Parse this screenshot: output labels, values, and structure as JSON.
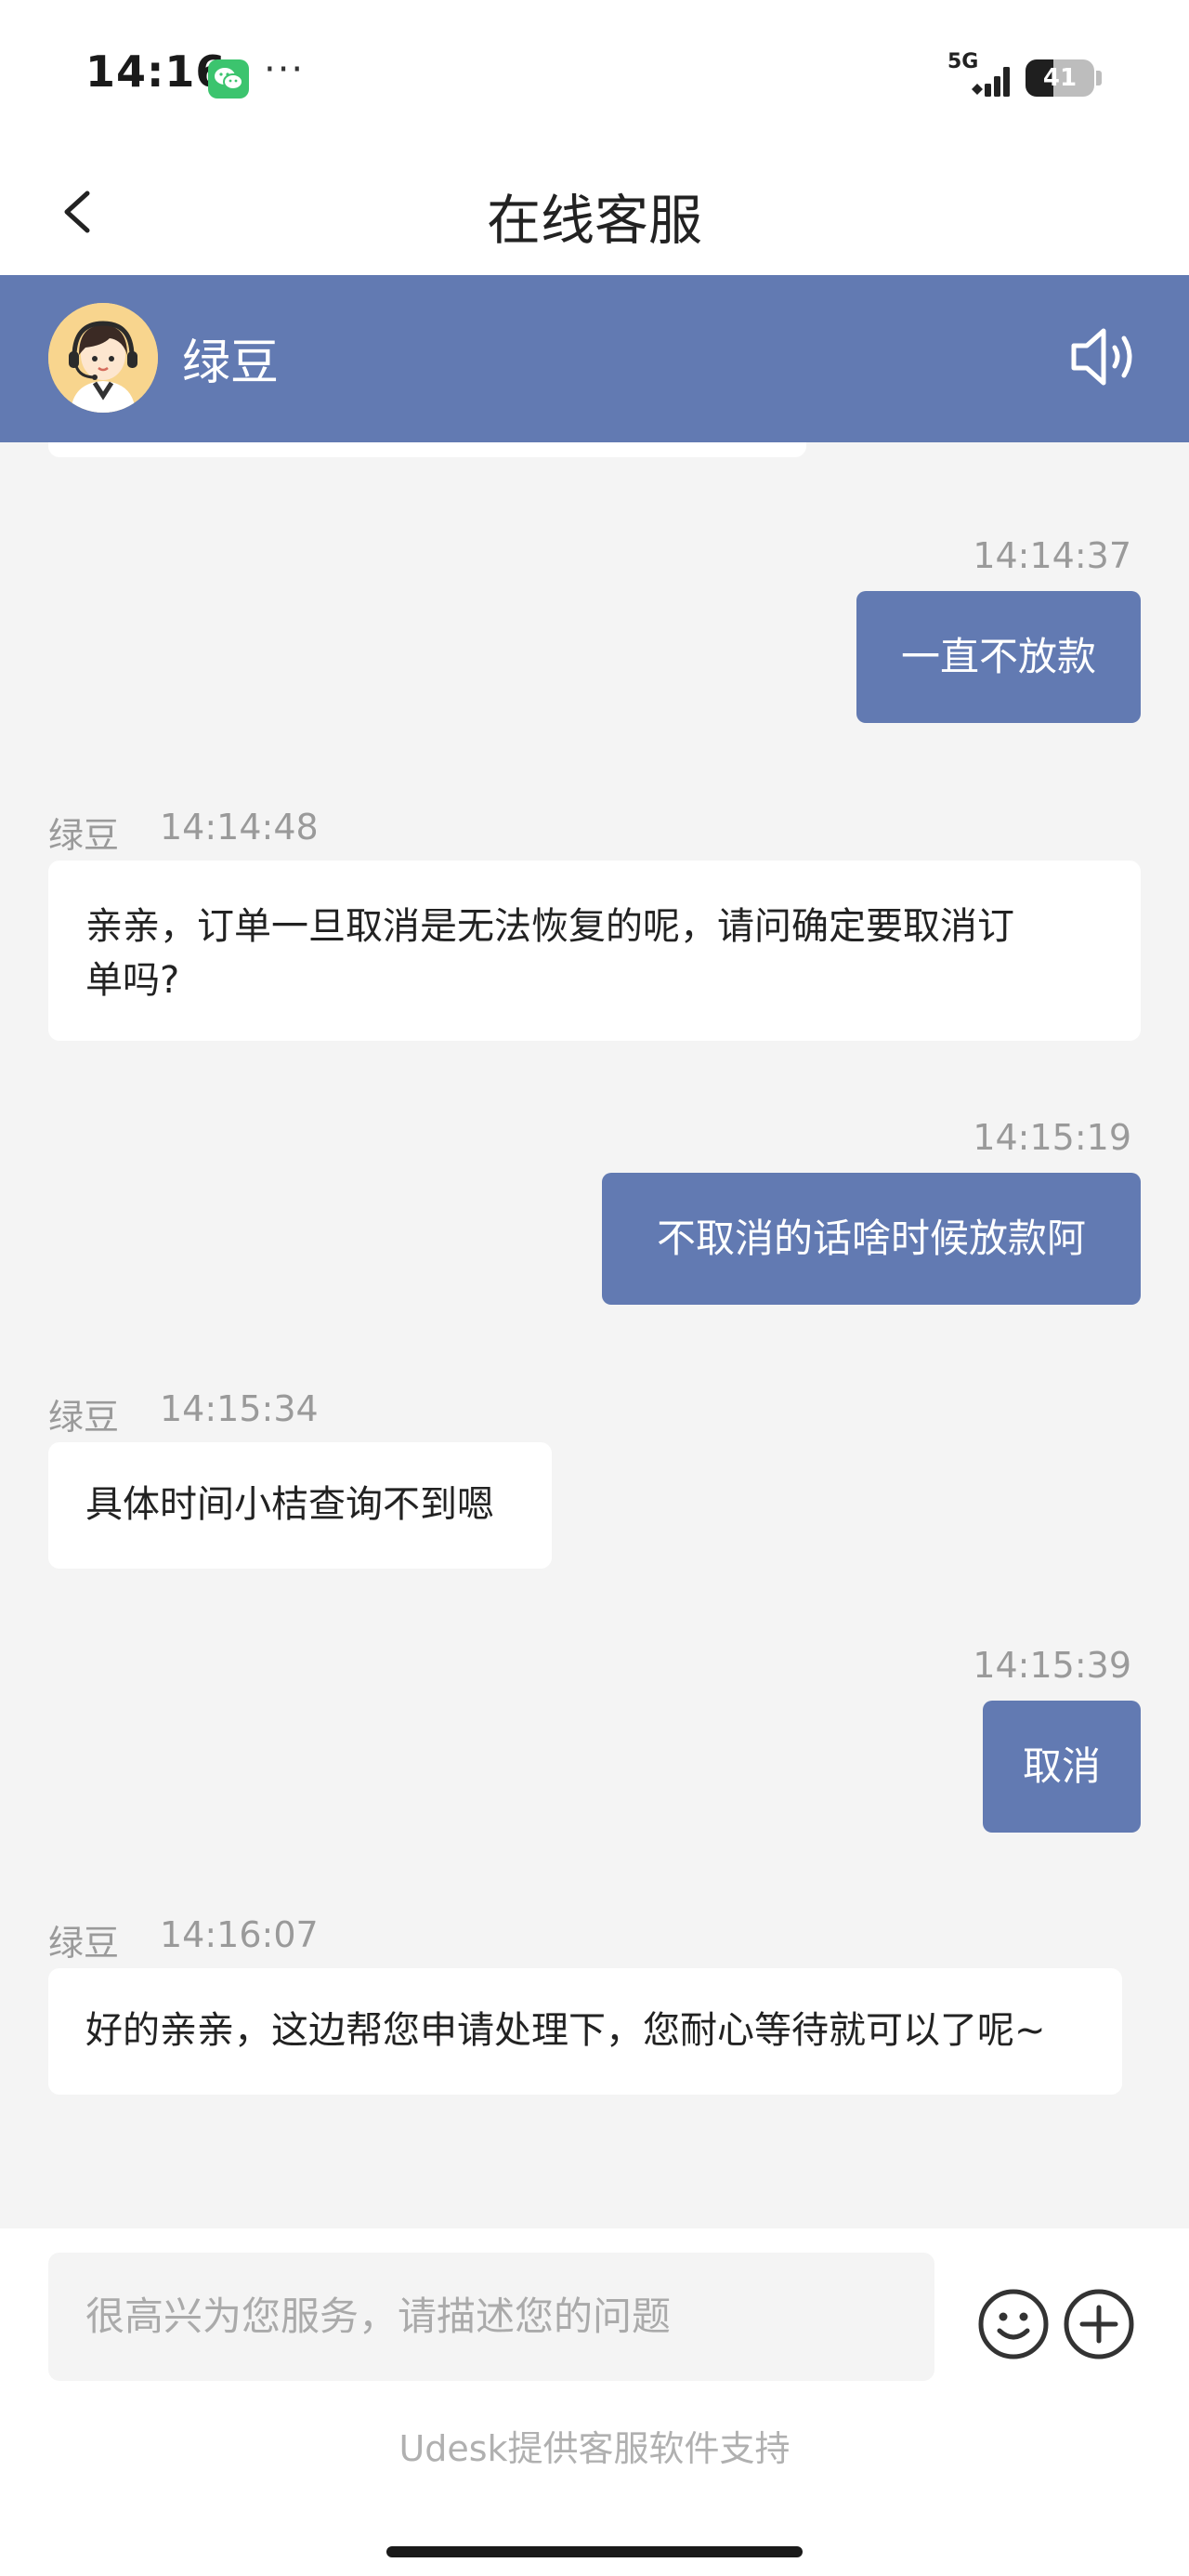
{
  "status_bar": {
    "time": "14:16",
    "dots": "···",
    "network": "5G",
    "battery": "41",
    "battery_level": 0.41
  },
  "nav": {
    "title": "在线客服"
  },
  "agent": {
    "name": "绿豆"
  },
  "messages": [
    {
      "side": "me",
      "time": "14:14:37",
      "text": "一直不放款"
    },
    {
      "side": "them",
      "sender": "绿豆",
      "time": "14:14:48",
      "lines": [
        "亲亲，订单一旦取消是无法恢复的呢，请问确定要取消订",
        "单吗?"
      ]
    },
    {
      "side": "me",
      "time": "14:15:19",
      "text": "不取消的话啥时候放款阿"
    },
    {
      "side": "them",
      "sender": "绿豆",
      "time": "14:15:34",
      "lines": [
        "具体时间小桔查询不到嗯"
      ]
    },
    {
      "side": "me",
      "time": "14:15:39",
      "text": "取消"
    },
    {
      "side": "them",
      "sender": "绿豆",
      "time": "14:16:07",
      "lines": [
        "好的亲亲，这边帮您申请处理下，您耐心等待就可以了呢~"
      ]
    }
  ],
  "input": {
    "placeholder": "很高兴为您服务，请描述您的问题"
  },
  "footer": {
    "powered_by": "Udesk提供客服软件支持"
  },
  "colors": {
    "accent": "#627ab2",
    "chat_background": "#f4f4f4",
    "bubble_them": "#ffffff",
    "timestamp": "#9a9a9a",
    "wechat_green": "#3cc46e"
  },
  "icons": [
    "wechat-icon",
    "signal-icon",
    "battery-icon",
    "back-chevron-icon",
    "agent-avatar",
    "speaker-icon",
    "emoji-icon",
    "plus-circle-icon"
  ]
}
